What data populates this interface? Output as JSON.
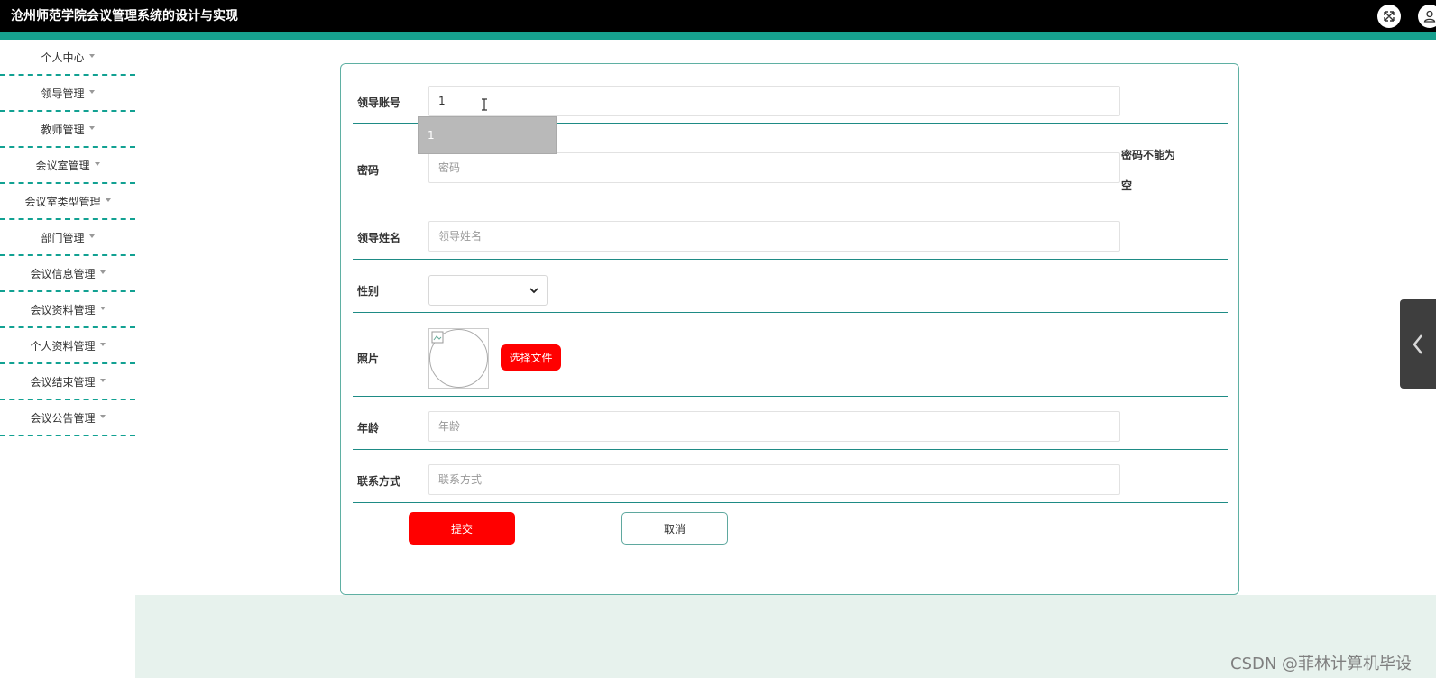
{
  "header": {
    "title": "沧州师范学院会议管理系统的设计与实现"
  },
  "sidebar": {
    "items": [
      {
        "label": "个人中心"
      },
      {
        "label": "领导管理"
      },
      {
        "label": "教师管理"
      },
      {
        "label": "会议室管理"
      },
      {
        "label": "会议室类型管理"
      },
      {
        "label": "部门管理"
      },
      {
        "label": "会议信息管理"
      },
      {
        "label": "会议资料管理"
      },
      {
        "label": "个人资料管理"
      },
      {
        "label": "会议结束管理"
      },
      {
        "label": "会议公告管理"
      }
    ]
  },
  "form": {
    "account": {
      "label": "领导账号",
      "value": "1"
    },
    "autocomplete_option": "1",
    "password": {
      "label": "密码",
      "placeholder": "密码",
      "error_line1": "密码不能为",
      "error_line2": "空"
    },
    "name": {
      "label": "领导姓名",
      "placeholder": "领导姓名"
    },
    "gender": {
      "label": "性别",
      "value": ""
    },
    "photo": {
      "label": "照片",
      "button": "选择文件"
    },
    "age": {
      "label": "年龄",
      "placeholder": "年龄"
    },
    "contact": {
      "label": "联系方式",
      "placeholder": "联系方式"
    },
    "submit": "提交",
    "cancel": "取消"
  },
  "watermark": "CSDN @菲林计算机毕设",
  "icons": {
    "fullscreen": "fullscreen-icon",
    "user": "user-icon",
    "collapse": "chevron-left-icon"
  },
  "colors": {
    "header_bg": "#000000",
    "accent": "#16a08e",
    "primary_button": "#ff0000",
    "card_border": "#5fb0a3"
  }
}
